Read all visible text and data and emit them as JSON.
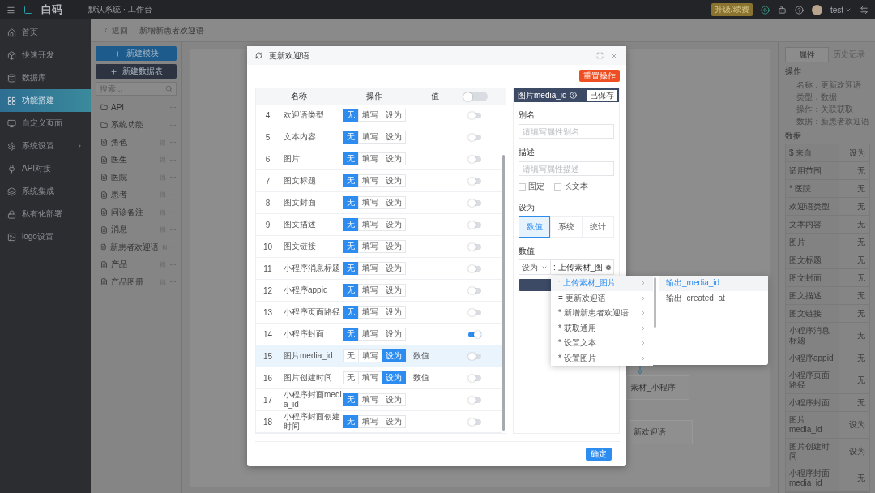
{
  "topbar": {
    "logo": "白码",
    "breadcrumb": "默认系统 · 工作台",
    "upgrade": "升级/续费",
    "user": "test"
  },
  "sidebar": {
    "items": [
      {
        "label": "首页",
        "selected": false,
        "has_children": false
      },
      {
        "label": "快速开发",
        "selected": false,
        "has_children": false
      },
      {
        "label": "数据库",
        "selected": false,
        "has_children": false
      },
      {
        "label": "功能搭建",
        "selected": true,
        "has_children": false
      },
      {
        "label": "自定义页面",
        "selected": false,
        "has_children": false
      },
      {
        "label": "系统设置",
        "selected": false,
        "has_children": true
      },
      {
        "label": "API对接",
        "selected": false,
        "has_children": false
      },
      {
        "label": "系统集成",
        "selected": false,
        "has_children": false
      },
      {
        "label": "私有化部署",
        "selected": false,
        "has_children": false
      },
      {
        "label": "logo设置",
        "selected": false,
        "has_children": false
      }
    ]
  },
  "page": {
    "back": "返回",
    "title": "新增新患者欢迎语"
  },
  "tree": {
    "buttons": [
      {
        "label": "新建模块",
        "kind": "primary"
      },
      {
        "label": "新建数据表",
        "kind": "dark"
      }
    ],
    "search": {
      "placeholder": "搜索..."
    },
    "items": [
      {
        "label": "API",
        "kind": "folder"
      },
      {
        "label": "系统功能",
        "kind": "folder"
      },
      {
        "label": "角色",
        "kind": "table"
      },
      {
        "label": "医生",
        "kind": "table"
      },
      {
        "label": "医院",
        "kind": "table"
      },
      {
        "label": "患者",
        "kind": "table"
      },
      {
        "label": "问诊备注",
        "kind": "table"
      },
      {
        "label": "消息",
        "kind": "table"
      },
      {
        "label": "新患者欢迎语",
        "kind": "table"
      },
      {
        "label": "产品",
        "kind": "table"
      },
      {
        "label": "产品图册",
        "kind": "table"
      }
    ]
  },
  "canvas": {
    "nodes": [
      "素材_小程序",
      "新欢迎语"
    ]
  },
  "inspector": {
    "tabs": [
      {
        "label": "属性",
        "selected": true
      },
      {
        "label": "历史记录",
        "selected": false
      }
    ],
    "operation": {
      "title": "操作",
      "rows": [
        "名称：更新欢迎语",
        "类型：数据",
        "操作：关联获取",
        "数据：新患者欢迎语"
      ]
    },
    "data": {
      "title": "数据",
      "rows": [
        {
          "label": "$ 来自",
          "value": "设为"
        },
        {
          "label": "适用范围",
          "value": "无"
        },
        {
          "label": "* 医院",
          "value": "无"
        },
        {
          "label": "欢迎语类型",
          "value": "无"
        },
        {
          "label": "文本内容",
          "value": "无"
        },
        {
          "label": "图片",
          "value": "无"
        },
        {
          "label": "图文标题",
          "value": "无"
        },
        {
          "label": "图文封面",
          "value": "无"
        },
        {
          "label": "图文描述",
          "value": "无"
        },
        {
          "label": "图文链接",
          "value": "无"
        },
        {
          "label": "小程序消息标题",
          "value": "无"
        },
        {
          "label": "小程序appid",
          "value": "无"
        },
        {
          "label": "小程序页面路径",
          "value": "无"
        },
        {
          "label": "小程序封面",
          "value": "无"
        },
        {
          "label": "图片media_id",
          "value": "设为"
        },
        {
          "label": "图片创建时间",
          "value": "设为"
        },
        {
          "label": "小程序封面media_id",
          "value": "无"
        }
      ]
    }
  },
  "modal": {
    "title": "更新欢迎语",
    "reset": "重置操作",
    "confirm": "确定",
    "table": {
      "columns": [
        "名称",
        "操作",
        "值"
      ],
      "header_switch_on": false,
      "rows": [
        {
          "index": "4",
          "name": "欢迎语类型",
          "ops": [
            {
              "label": "无",
              "selected": true
            },
            {
              "label": "填写",
              "selected": false
            },
            {
              "label": "设为",
              "selected": false
            }
          ],
          "switch_on": false,
          "selected": false
        },
        {
          "index": "5",
          "name": "文本内容",
          "ops": [
            {
              "label": "无",
              "selected": true
            },
            {
              "label": "填写",
              "selected": false
            },
            {
              "label": "设为",
              "selected": false
            }
          ],
          "switch_on": false,
          "selected": false
        },
        {
          "index": "6",
          "name": "图片",
          "ops": [
            {
              "label": "无",
              "selected": true
            },
            {
              "label": "填写",
              "selected": false
            },
            {
              "label": "设为",
              "selected": false
            }
          ],
          "switch_on": false,
          "selected": false
        },
        {
          "index": "7",
          "name": "图文标题",
          "ops": [
            {
              "label": "无",
              "selected": true
            },
            {
              "label": "填写",
              "selected": false
            },
            {
              "label": "设为",
              "selected": false
            }
          ],
          "switch_on": false,
          "selected": false
        },
        {
          "index": "8",
          "name": "图文封面",
          "ops": [
            {
              "label": "无",
              "selected": true
            },
            {
              "label": "填写",
              "selected": false
            },
            {
              "label": "设为",
              "selected": false
            }
          ],
          "switch_on": false,
          "selected": false
        },
        {
          "index": "9",
          "name": "图文描述",
          "ops": [
            {
              "label": "无",
              "selected": true
            },
            {
              "label": "填写",
              "selected": false
            },
            {
              "label": "设为",
              "selected": false
            }
          ],
          "switch_on": false,
          "selected": false
        },
        {
          "index": "10",
          "name": "图文链接",
          "ops": [
            {
              "label": "无",
              "selected": true
            },
            {
              "label": "填写",
              "selected": false
            },
            {
              "label": "设为",
              "selected": false
            }
          ],
          "switch_on": false,
          "selected": false
        },
        {
          "index": "11",
          "name": "小程序消息标题",
          "ops": [
            {
              "label": "无",
              "selected": true
            },
            {
              "label": "填写",
              "selected": false
            },
            {
              "label": "设为",
              "selected": false
            }
          ],
          "switch_on": false,
          "selected": false
        },
        {
          "index": "12",
          "name": "小程序appid",
          "ops": [
            {
              "label": "无",
              "selected": true
            },
            {
              "label": "填写",
              "selected": false
            },
            {
              "label": "设为",
              "selected": false
            }
          ],
          "switch_on": false,
          "selected": false
        },
        {
          "index": "13",
          "name": "小程序页面路径",
          "ops": [
            {
              "label": "无",
              "selected": true
            },
            {
              "label": "填写",
              "selected": false
            },
            {
              "label": "设为",
              "selected": false
            }
          ],
          "switch_on": false,
          "selected": false
        },
        {
          "index": "14",
          "name": "小程序封面",
          "ops": [
            {
              "label": "无",
              "selected": true
            },
            {
              "label": "填写",
              "selected": false
            },
            {
              "label": "设为",
              "selected": false
            }
          ],
          "switch_on": true,
          "selected": false
        },
        {
          "index": "15",
          "name": "图片media_id",
          "ops": [
            {
              "label": "无",
              "selected": false
            },
            {
              "label": "填写",
              "selected": false
            },
            {
              "label": "设为",
              "selected": true
            }
          ],
          "value": "数值",
          "switch_on": false,
          "selected": true
        },
        {
          "index": "16",
          "name": "图片创建时间",
          "ops": [
            {
              "label": "无",
              "selected": false
            },
            {
              "label": "填写",
              "selected": false
            },
            {
              "label": "设为",
              "selected": true
            }
          ],
          "value": "数值",
          "switch_on": false,
          "selected": false
        },
        {
          "index": "17",
          "name": "小程序封面media_id",
          "ops": [
            {
              "label": "无",
              "selected": true
            },
            {
              "label": "填写",
              "selected": false
            },
            {
              "label": "设为",
              "selected": false
            }
          ],
          "switch_on": false,
          "selected": false
        },
        {
          "index": "18",
          "name": "小程序封面创建时间",
          "ops": [
            {
              "label": "无",
              "selected": true
            },
            {
              "label": "填写",
              "selected": false
            },
            {
              "label": "设为",
              "selected": false
            }
          ],
          "switch_on": false,
          "selected": false
        }
      ]
    },
    "field": {
      "title": "图片media_id",
      "saved": "已保存",
      "alias": {
        "label": "别名",
        "placeholder": "请填写属性别名"
      },
      "description": {
        "label": "描述",
        "placeholder": "请填写属性描述"
      },
      "checks": [
        {
          "label": "固定",
          "checked": false
        },
        {
          "label": "长文本",
          "checked": false
        }
      ],
      "set_as": {
        "label": "设为",
        "options": [
          {
            "label": "数值",
            "selected": true
          },
          {
            "label": "系统",
            "selected": false
          },
          {
            "label": "统计",
            "selected": false
          }
        ]
      },
      "value": {
        "label": "数值",
        "mode": "设为",
        "text": ": 上传素材_图"
      }
    },
    "dropdown": {
      "items": [
        {
          "label": ": 上传素材_图片",
          "selected": true
        },
        {
          "label": "= 更新欢迎语",
          "selected": false
        },
        {
          "label": "* 新增新患者欢迎语",
          "selected": false
        },
        {
          "label": "* 获取通用",
          "selected": false
        },
        {
          "label": "* 设置文本",
          "selected": false
        },
        {
          "label": "* 设置图片",
          "selected": false
        }
      ],
      "submenu": [
        {
          "label": "输出_media_id",
          "selected": true
        },
        {
          "label": "输出_created_at",
          "selected": false
        }
      ]
    }
  }
}
